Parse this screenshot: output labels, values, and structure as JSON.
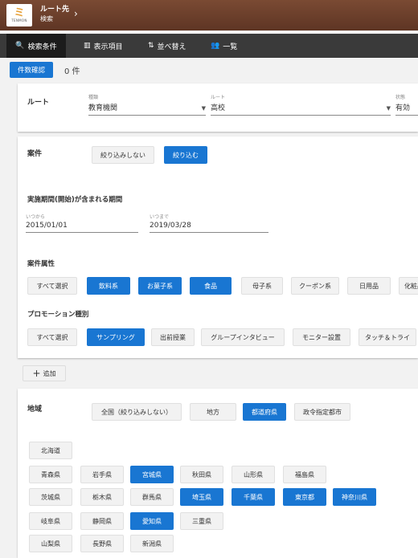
{
  "header": {
    "line1": "ルート先",
    "line2": "検索",
    "logo_glyph": "ミ",
    "logo_brand": "TENMON"
  },
  "tabs": [
    {
      "icon": "search-icon",
      "glyph": "🔍",
      "label": "検索条件"
    },
    {
      "icon": "columns-icon",
      "glyph": "▥",
      "label": "表示項目"
    },
    {
      "icon": "sort-icon",
      "glyph": "⇅",
      "label": "並べ替え"
    },
    {
      "icon": "people-icon",
      "glyph": "👥",
      "label": "一覧"
    }
  ],
  "count": {
    "button": "件数確認",
    "value": "0 件"
  },
  "route": {
    "title": "ルート",
    "fields": [
      {
        "label": "種類",
        "value": "教育機関"
      },
      {
        "label": "ルート",
        "value": "高校"
      },
      {
        "label": "状態",
        "value": "有効"
      }
    ]
  },
  "case": {
    "title": "案件",
    "filter_off": "絞り込みしない",
    "filter_on": "絞り込む",
    "period_title": "実施期間(開始)が含まれる期間",
    "from_label": "いつから",
    "from_value": "2015/01/01",
    "to_label": "いつまで",
    "to_value": "2019/03/28",
    "attr_title": "案件属性",
    "attrs": [
      {
        "label": "すべて選択",
        "on": false
      },
      {
        "label": "飲料系",
        "on": true
      },
      {
        "label": "お菓子系",
        "on": true
      },
      {
        "label": "食品",
        "on": true
      },
      {
        "label": "母子系",
        "on": false
      },
      {
        "label": "クーポン系",
        "on": false
      },
      {
        "label": "日用品",
        "on": false
      },
      {
        "label": "化粧品",
        "on": false
      }
    ],
    "promo_title": "プロモーション種別",
    "promos": [
      {
        "label": "すべて選択",
        "on": false
      },
      {
        "label": "サンプリング",
        "on": true
      },
      {
        "label": "出前授業",
        "on": false
      },
      {
        "label": "グループインタビュー",
        "on": false
      },
      {
        "label": "モニター設置",
        "on": false
      },
      {
        "label": "タッチ＆トライ",
        "on": false
      }
    ]
  },
  "add": {
    "label": "追加"
  },
  "region": {
    "title": "地域",
    "modes": [
      {
        "label": "全国（絞り込みしない）",
        "on": false
      },
      {
        "label": "地方",
        "on": false
      },
      {
        "label": "都道府県",
        "on": true
      },
      {
        "label": "政令指定都市",
        "on": false
      }
    ],
    "prefs": [
      [
        {
          "label": "北海道",
          "on": false
        }
      ],
      [
        {
          "label": "青森県",
          "on": false
        },
        {
          "label": "岩手県",
          "on": false
        },
        {
          "label": "宮城県",
          "on": true
        },
        {
          "label": "秋田県",
          "on": false
        },
        {
          "label": "山形県",
          "on": false
        },
        {
          "label": "福島県",
          "on": false
        }
      ],
      [
        {
          "label": "茨城県",
          "on": false
        },
        {
          "label": "栃木県",
          "on": false
        },
        {
          "label": "群馬県",
          "on": false
        },
        {
          "label": "埼玉県",
          "on": true
        },
        {
          "label": "千葉県",
          "on": true
        },
        {
          "label": "東京都",
          "on": true
        },
        {
          "label": "神奈川県",
          "on": true
        }
      ],
      [
        {
          "label": "岐阜県",
          "on": false
        },
        {
          "label": "静岡県",
          "on": false
        },
        {
          "label": "愛知県",
          "on": true
        },
        {
          "label": "三重県",
          "on": false
        }
      ],
      [
        {
          "label": "山梨県",
          "on": false
        },
        {
          "label": "長野県",
          "on": false
        },
        {
          "label": "新潟県",
          "on": false
        }
      ]
    ]
  }
}
